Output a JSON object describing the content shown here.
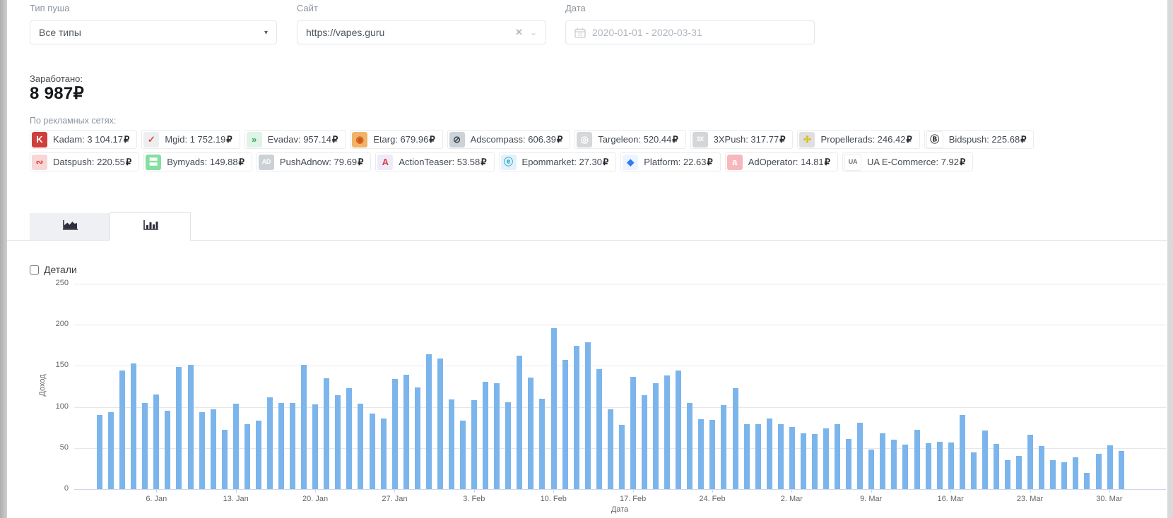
{
  "currency": "₽",
  "filters": {
    "push_type": {
      "label": "Тип пуша",
      "value": "Все типы"
    },
    "site": {
      "label": "Сайт",
      "value": "https://vapes.guru"
    },
    "date": {
      "label": "Дата",
      "value": "2020-01-01 - 2020-03-31"
    }
  },
  "earnings": {
    "label": "Заработано:",
    "value": "8 987₽"
  },
  "networks": {
    "label": "По рекламных сетях:",
    "items": [
      {
        "name": "Kadam",
        "amount": "3 104.17",
        "icon": {
          "name": "kadam-icon",
          "glyph": "K",
          "bg": "#cf3f3b",
          "color": "#ffffff"
        }
      },
      {
        "name": "Mgid",
        "amount": "1 752.19",
        "icon": {
          "name": "mgid-icon",
          "glyph": "✓",
          "bg": "#eceef0",
          "color": "#e0493f"
        }
      },
      {
        "name": "Evadav",
        "amount": "957.14",
        "icon": {
          "name": "evadav-icon",
          "glyph": "»",
          "bg": "#dff3e6",
          "color": "#36a85c"
        }
      },
      {
        "name": "Etarg",
        "amount": "679.96",
        "icon": {
          "name": "etarg-icon",
          "glyph": "◉",
          "bg": "#efb469",
          "color": "#d35717"
        }
      },
      {
        "name": "Adscompass",
        "amount": "606.39",
        "icon": {
          "name": "adscompass-icon",
          "glyph": "⊘",
          "bg": "#ccd2d7",
          "color": "#3a4750"
        }
      },
      {
        "name": "Targeleon",
        "amount": "520.44",
        "icon": {
          "name": "targeleon-icon",
          "glyph": "◎",
          "bg": "#d5d8db",
          "color": "#ffffff"
        }
      },
      {
        "name": "3XPush",
        "amount": "317.77",
        "icon": {
          "name": "3xpush-icon",
          "glyph": "3X",
          "bg": "#d3d7da",
          "color": "#ffffff",
          "small": true
        }
      },
      {
        "name": "Propellerads",
        "amount": "246.42",
        "icon": {
          "name": "propellerads-icon",
          "glyph": "✣",
          "bg": "#dfdfdf",
          "color": "#d8c011"
        }
      },
      {
        "name": "Bidspush",
        "amount": "225.68",
        "icon": {
          "name": "bidspush-icon",
          "glyph": "Ⓑ",
          "bg": "#ffffff",
          "color": "#2b2b2b"
        }
      },
      {
        "name": "Datspush",
        "amount": "220.55",
        "icon": {
          "name": "datspush-icon",
          "glyph": "∾",
          "bg": "#f7d6d6",
          "color": "#e04848"
        }
      },
      {
        "name": "Bymyads",
        "amount": "149.88",
        "icon": {
          "name": "bymyads-icon",
          "glyph": "〓",
          "bg": "#84dfa0",
          "color": "#ffffff"
        }
      },
      {
        "name": "PushAdnow",
        "amount": "79.69",
        "icon": {
          "name": "pushadnow-icon",
          "glyph": "AD",
          "bg": "#ccd1d5",
          "color": "#ffffff",
          "small": true
        }
      },
      {
        "name": "ActionTeaser",
        "amount": "53.58",
        "icon": {
          "name": "actionteaser-icon",
          "glyph": "A",
          "bg": "#eceafb",
          "color": "#e23b3b"
        }
      },
      {
        "name": "Epommarket",
        "amount": "27.30",
        "icon": {
          "name": "epommarket-icon",
          "glyph": "ⓔ",
          "bg": "#e2f2f8",
          "color": "#28a7cf"
        }
      },
      {
        "name": "Platform",
        "amount": "22.63",
        "icon": {
          "name": "platform-icon",
          "glyph": "◆",
          "bg": "#eef4ff",
          "color": "#2f7df6"
        }
      },
      {
        "name": "AdOperator",
        "amount": "14.81",
        "icon": {
          "name": "adoperator-icon",
          "glyph": "a",
          "bg": "#f5b8bc",
          "color": "#ffffff"
        }
      },
      {
        "name": "UA E-Commerce",
        "amount": "7.92",
        "icon": {
          "name": "ua-ecommerce-icon",
          "glyph": "UA",
          "bg": "#ffffff",
          "color": "#6d747c",
          "small": true
        }
      }
    ]
  },
  "tabs": {
    "area_tab": "area-chart",
    "bars_tab": "bar-chart",
    "active": "bar-chart"
  },
  "details": {
    "label": "Детали",
    "checked": false
  },
  "icons": {
    "select_arrow": "▾",
    "clear": "✕",
    "chevron": "⌄"
  },
  "chart_data": {
    "type": "bar",
    "title": "",
    "xlabel": "Дата",
    "ylabel": "Доход",
    "x_range": [
      "2020-01-01",
      "2020-03-31"
    ],
    "x_unit": "day",
    "ylim": [
      0,
      250
    ],
    "yticks": [
      0,
      50,
      100,
      150,
      200,
      250
    ],
    "grid": true,
    "legend": false,
    "bar_color": "#7cb5ec",
    "values": [
      90,
      94,
      144,
      153,
      105,
      115,
      95,
      149,
      151,
      94,
      97,
      72,
      104,
      79,
      83,
      112,
      105,
      105,
      151,
      103,
      135,
      114,
      123,
      104,
      92,
      86,
      134,
      139,
      124,
      164,
      159,
      109,
      83,
      108,
      131,
      129,
      106,
      162,
      136,
      110,
      196,
      157,
      174,
      179,
      146,
      97,
      78,
      137,
      114,
      129,
      138,
      144,
      105,
      85,
      84,
      102,
      123,
      79,
      79,
      86,
      79,
      76,
      68,
      67,
      74,
      79,
      61,
      81,
      48,
      68,
      60,
      54,
      72,
      56,
      58,
      57,
      90,
      45,
      71,
      55,
      35,
      40,
      66,
      52,
      35,
      33,
      39,
      20,
      43,
      53,
      46
    ],
    "xticks": [
      {
        "day": 5,
        "label": "6. Jan"
      },
      {
        "day": 12,
        "label": "13. Jan"
      },
      {
        "day": 19,
        "label": "20. Jan"
      },
      {
        "day": 26,
        "label": "27. Jan"
      },
      {
        "day": 33,
        "label": "3. Feb"
      },
      {
        "day": 40,
        "label": "10. Feb"
      },
      {
        "day": 47,
        "label": "17. Feb"
      },
      {
        "day": 54,
        "label": "24. Feb"
      },
      {
        "day": 61,
        "label": "2. Mar"
      },
      {
        "day": 68,
        "label": "9. Mar"
      },
      {
        "day": 75,
        "label": "16. Mar"
      },
      {
        "day": 82,
        "label": "23. Mar"
      },
      {
        "day": 89,
        "label": "30. Mar"
      }
    ]
  }
}
